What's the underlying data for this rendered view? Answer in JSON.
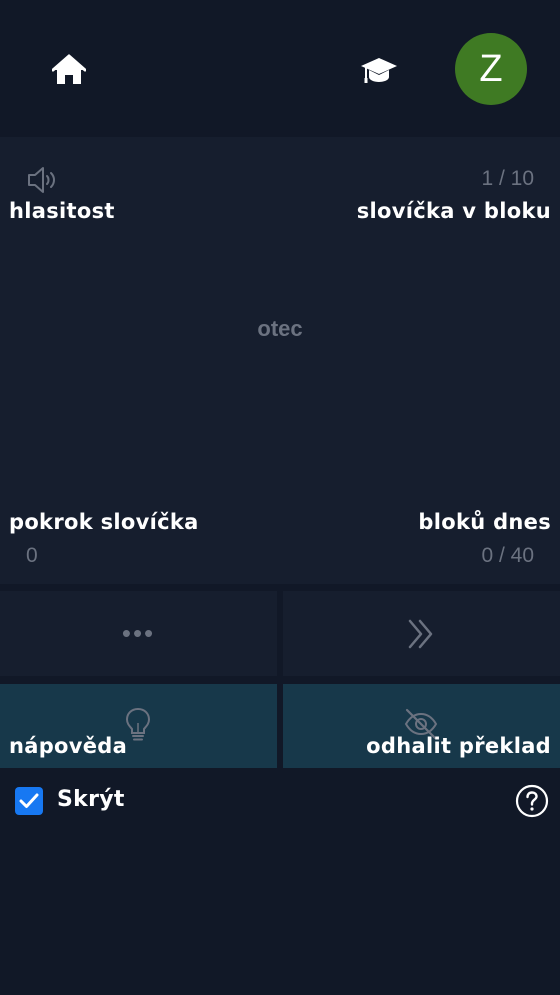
{
  "topbar": {
    "home_icon": "home-icon",
    "cap_icon": "graduation-cap-icon",
    "avatar_letter": "Z",
    "avatar_color": "#3f7a23"
  },
  "card": {
    "volume_label": "hlasitost",
    "word_counter": "1 / 10",
    "words_in_block_label": "slovíčka v bloku",
    "word": "otec",
    "progress_label": "pokrok slovíčka",
    "progress_value": "0",
    "blocks_today_label": "bloků dnes",
    "blocks_today_value": "0 / 40"
  },
  "actions": {
    "more_text": "•••",
    "next_icon": "double-chevron-right-icon",
    "hint_label": "nápověda",
    "hint_icon": "lightbulb-icon",
    "reveal_label": "odhalit překlad",
    "reveal_icon": "eye-slash-icon"
  },
  "footer": {
    "hide_label": "Skrýt",
    "hide_checked": true,
    "help_icon": "question-circle-icon"
  },
  "colors": {
    "background": "#111827",
    "card": "#161e2e",
    "teal_tile": "#17384a",
    "muted": "#6b7280",
    "checkbox": "#1778f2"
  }
}
